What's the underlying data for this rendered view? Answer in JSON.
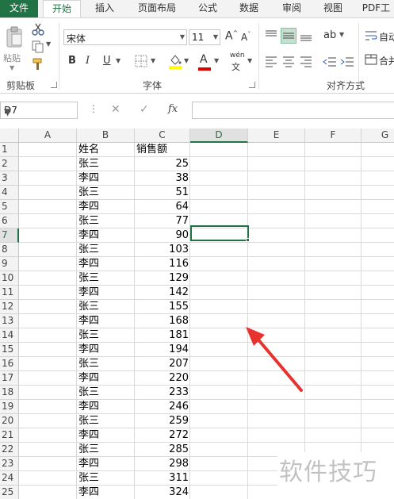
{
  "tabs": [
    {
      "label": "文件"
    },
    {
      "label": "开始"
    },
    {
      "label": "插入"
    },
    {
      "label": "页面布局"
    },
    {
      "label": "公式"
    },
    {
      "label": "数据"
    },
    {
      "label": "审阅"
    },
    {
      "label": "视图"
    },
    {
      "label": "PDF工"
    }
  ],
  "ribbon": {
    "clipboard": {
      "paste_label": "粘贴",
      "group_label": "剪贴板"
    },
    "font": {
      "font_name": "宋体",
      "font_size": "11",
      "bold": "B",
      "italic": "I",
      "underline": "U",
      "group_label": "字体",
      "phonetic": "wén"
    },
    "alignment": {
      "group_label": "对齐方式",
      "wrap_label": "自动",
      "merge_label": "合并"
    }
  },
  "formula_bar": {
    "name_box": "D7",
    "cancel": "✕",
    "enter": "✓",
    "fx": "fx",
    "formula": ""
  },
  "sheet": {
    "columns": [
      "A",
      "B",
      "C",
      "D",
      "E",
      "F",
      "G"
    ],
    "selected_cell": "D7",
    "rows": [
      {
        "num": "1",
        "b": "姓名",
        "c": "销售额"
      },
      {
        "num": "2",
        "b": "张三",
        "c": "25"
      },
      {
        "num": "3",
        "b": "李四",
        "c": "38"
      },
      {
        "num": "4",
        "b": "张三",
        "c": "51"
      },
      {
        "num": "5",
        "b": "李四",
        "c": "64"
      },
      {
        "num": "6",
        "b": "张三",
        "c": "77"
      },
      {
        "num": "7",
        "b": "李四",
        "c": "90"
      },
      {
        "num": "8",
        "b": "张三",
        "c": "103"
      },
      {
        "num": "9",
        "b": "李四",
        "c": "116"
      },
      {
        "num": "10",
        "b": "张三",
        "c": "129"
      },
      {
        "num": "11",
        "b": "李四",
        "c": "142"
      },
      {
        "num": "12",
        "b": "张三",
        "c": "155"
      },
      {
        "num": "13",
        "b": "李四",
        "c": "168"
      },
      {
        "num": "14",
        "b": "张三",
        "c": "181"
      },
      {
        "num": "15",
        "b": "李四",
        "c": "194"
      },
      {
        "num": "16",
        "b": "张三",
        "c": "207"
      },
      {
        "num": "17",
        "b": "李四",
        "c": "220"
      },
      {
        "num": "18",
        "b": "张三",
        "c": "233"
      },
      {
        "num": "19",
        "b": "李四",
        "c": "246"
      },
      {
        "num": "20",
        "b": "张三",
        "c": "259"
      },
      {
        "num": "21",
        "b": "李四",
        "c": "272"
      },
      {
        "num": "22",
        "b": "张三",
        "c": "285"
      },
      {
        "num": "23",
        "b": "李四",
        "c": "298"
      },
      {
        "num": "24",
        "b": "张三",
        "c": "311"
      },
      {
        "num": "25",
        "b": "李四",
        "c": "324"
      }
    ]
  },
  "annotation": {
    "arrow_color": "#e8322e"
  },
  "watermark": {
    "text": "软件技巧"
  },
  "colors": {
    "accent": "#217346"
  }
}
